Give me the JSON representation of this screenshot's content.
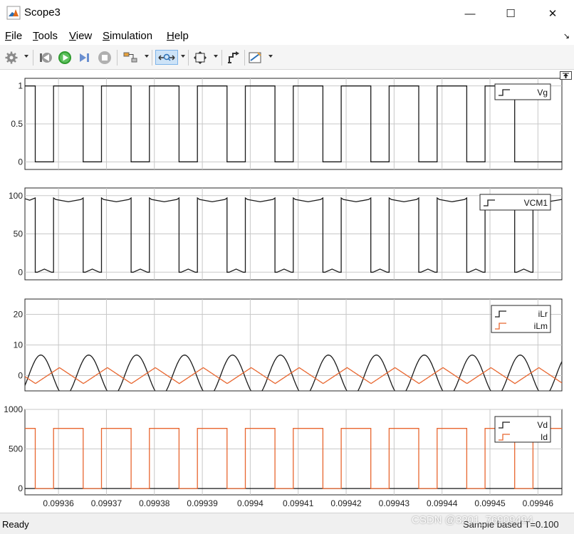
{
  "window": {
    "title": "Scope3",
    "minimize_glyph": "—",
    "maximize_glyph": "☐",
    "close_glyph": "✕"
  },
  "menu": {
    "items": [
      {
        "label": "File",
        "accel": "F",
        "rest": "ile"
      },
      {
        "label": "Tools",
        "accel": "T",
        "rest": "ools"
      },
      {
        "label": "View",
        "accel": "V",
        "rest": "iew"
      },
      {
        "label": "Simulation",
        "accel": "S",
        "rest": "imulation"
      },
      {
        "label": "Help",
        "accel": "H",
        "rest": "elp"
      }
    ],
    "overflow_glyph": "↘"
  },
  "toolbar": {
    "icons": [
      "gear-icon",
      "step-back-icon",
      "run-icon",
      "step-forward-icon",
      "stop-icon",
      "highlight-block-icon",
      "zoom-x-icon",
      "autoscale-icon",
      "style-icon",
      "measurements-icon"
    ]
  },
  "colors": {
    "signal_black": "#1a1a1a",
    "signal_orange": "#e8662f",
    "grid": "#c8c8c8",
    "axes_bg": "#ffffff"
  },
  "status": {
    "left": "Ready",
    "right": "Sample based  T=0.100",
    "watermark": "CSDN @3201_76909494"
  },
  "chart_data": [
    {
      "type": "line",
      "title": "",
      "xlim": [
        0.099353,
        0.099465
      ],
      "ylim": [
        -0.1,
        1.1
      ],
      "yticks": [
        {
          "v": 1,
          "label": "1"
        },
        {
          "v": 0.5,
          "label": "0.5"
        },
        {
          "v": 0,
          "label": "0"
        }
      ],
      "legend_placement": "top-right",
      "series": [
        {
          "name": "Vg",
          "color": "#1a1a1a",
          "x": [
            0.099353,
            0.09935515,
            0.09935515,
            0.09935897,
            0.09935897,
            0.09936515,
            0.09936515,
            0.09936897,
            0.09936897,
            0.09937515,
            0.09937515,
            0.09937897,
            0.09937897,
            0.09938515,
            0.09938515,
            0.09938897,
            0.09938897,
            0.09939515,
            0.09939515,
            0.09939897,
            0.09939897,
            0.09940515,
            0.09940515,
            0.09940897,
            0.09940897,
            0.09941515,
            0.09941515,
            0.09941897,
            0.09941897,
            0.09942515,
            0.09942515,
            0.09942897,
            0.09942897,
            0.09943515,
            0.09943515,
            0.09943897,
            0.09943897,
            0.09944515,
            0.09944515,
            0.09944897,
            0.09944897,
            0.09945515,
            0.09945515,
            0.099465
          ],
          "y": [
            1,
            1,
            0,
            0,
            1,
            1,
            0,
            0,
            1,
            1,
            0,
            0,
            1,
            1,
            0,
            0,
            1,
            1,
            0,
            0,
            1,
            1,
            0,
            0,
            1,
            1,
            0,
            0,
            1,
            1,
            0,
            0,
            1,
            1,
            0,
            0,
            1,
            1,
            0,
            0,
            1,
            1,
            0,
            0
          ]
        }
      ]
    },
    {
      "type": "line",
      "title": "",
      "xlim": [
        0.099353,
        0.099465
      ],
      "ylim": [
        -10,
        110
      ],
      "yticks": [
        {
          "v": 100,
          "label": "100"
        },
        {
          "v": 50,
          "label": "50"
        },
        {
          "v": 0,
          "label": "0"
        }
      ],
      "legend_placement": "top-right",
      "series": [
        {
          "name": "VCM1",
          "color": "#1a1a1a",
          "x": [
            0.099353,
            0.099354,
            0.09935515,
            0.09935515,
            0.0993556,
            0.09935706,
            0.09935852,
            0.09935897,
            0.09935897,
            0.0993594,
            0.09936206,
            0.09936472,
            0.09936515,
            0.09936515,
            0.0993656,
            0.09936706,
            0.09936852,
            0.09936897,
            0.09936897,
            0.0993694,
            0.09937206,
            0.09937472,
            0.09937515,
            0.09937515,
            0.0993756,
            0.09937706,
            0.09937852,
            0.09937897,
            0.09937897,
            0.0993794,
            0.09938206,
            0.09938472,
            0.09938515,
            0.09938515,
            0.0993856,
            0.09938706,
            0.09938852,
            0.09938897,
            0.09938897,
            0.0993894,
            0.09939206,
            0.09939472,
            0.09939515,
            0.09939515,
            0.0993956,
            0.09939706,
            0.09939852,
            0.09939897,
            0.09939897,
            0.0993994,
            0.09940206,
            0.09940472,
            0.09940515,
            0.09940515,
            0.0994056,
            0.09940706,
            0.09940852,
            0.09940897,
            0.09940897,
            0.0994094,
            0.09941206,
            0.09941472,
            0.09941515,
            0.09941515,
            0.0994156,
            0.09941706,
            0.09941852,
            0.09941897,
            0.09941897,
            0.0994194,
            0.09942206,
            0.09942472,
            0.09942515,
            0.09942515,
            0.0994256,
            0.09942706,
            0.09942852,
            0.09942897,
            0.09942897,
            0.0994294,
            0.09943206,
            0.09943472,
            0.09943515,
            0.09943515,
            0.0994356,
            0.09943706,
            0.09943852,
            0.09943897,
            0.09943897,
            0.0994394,
            0.09944206,
            0.09944472,
            0.09944515,
            0.09944515,
            0.0994456,
            0.09944706,
            0.09944852,
            0.09944897,
            0.09944897,
            0.0994494,
            0.09945206,
            0.09945472,
            0.09945515,
            0.09945515,
            0.0994556,
            0.09945706,
            0.09945852,
            0.09945897,
            0.09945897,
            0.0994594,
            0.099462,
            0.099465
          ],
          "y": [
            96,
            94,
            97,
            0,
            0,
            4,
            0,
            0,
            97,
            95,
            92,
            95,
            97,
            0,
            0,
            4,
            0,
            0,
            97,
            95,
            92,
            95,
            97,
            0,
            0,
            4,
            0,
            0,
            97,
            95,
            92,
            95,
            97,
            0,
            0,
            4,
            0,
            0,
            97,
            95,
            92,
            95,
            97,
            0,
            0,
            4,
            0,
            0,
            97,
            95,
            92,
            95,
            97,
            0,
            0,
            4,
            0,
            0,
            97,
            95,
            92,
            95,
            97,
            0,
            0,
            4,
            0,
            0,
            97,
            95,
            92,
            95,
            97,
            0,
            0,
            4,
            0,
            0,
            97,
            95,
            92,
            95,
            97,
            0,
            0,
            4,
            0,
            0,
            97,
            95,
            92,
            95,
            97,
            0,
            0,
            4,
            0,
            0,
            97,
            95,
            92,
            95,
            97,
            0,
            0,
            4,
            0,
            0,
            97,
            95,
            92,
            95
          ]
        }
      ]
    },
    {
      "type": "line",
      "title": "",
      "xlim": [
        0.099353,
        0.099465
      ],
      "ylim": [
        -5,
        25
      ],
      "yticks": [
        {
          "v": 20,
          "label": "20"
        },
        {
          "v": 10,
          "label": "10"
        },
        {
          "v": 0,
          "label": "0"
        }
      ],
      "legend_placement": "top-right",
      "series": [
        {
          "name": "iLr",
          "color": "#1a1a1a",
          "model": "sine",
          "amplitude": 6.7,
          "period": 1e-05,
          "peak_x": 0.0993563,
          "offset": 0
        },
        {
          "name": "iLm",
          "color": "#e8662f",
          "model": "triangle",
          "amplitude": 2.6,
          "period": 1e-05,
          "peak_x": 0.0993602,
          "offset": 0
        }
      ]
    },
    {
      "type": "line",
      "title": "",
      "xlim": [
        0.099353,
        0.099465
      ],
      "ylim": [
        -80,
        1000
      ],
      "yticks": [
        {
          "v": 1000,
          "label": "1000"
        },
        {
          "v": 500,
          "label": "500"
        },
        {
          "v": 0,
          "label": "0"
        }
      ],
      "legend_placement": "top-right",
      "series": [
        {
          "name": "Vd",
          "color": "#1a1a1a",
          "x": [
            0.099353,
            0.099465
          ],
          "y": [
            0,
            0
          ]
        },
        {
          "name": "Id",
          "color": "#e8662f",
          "x": [
            0.099353,
            0.09935515,
            0.09935515,
            0.09935897,
            0.09935897,
            0.09936515,
            0.09936515,
            0.09936897,
            0.09936897,
            0.09937515,
            0.09937515,
            0.09937897,
            0.09937897,
            0.09938515,
            0.09938515,
            0.09938897,
            0.09938897,
            0.09939515,
            0.09939515,
            0.09939897,
            0.09939897,
            0.09940515,
            0.09940515,
            0.09940897,
            0.09940897,
            0.09941515,
            0.09941515,
            0.09941897,
            0.09941897,
            0.09942515,
            0.09942515,
            0.09942897,
            0.09942897,
            0.09943515,
            0.09943515,
            0.09943897,
            0.09943897,
            0.09944515,
            0.09944515,
            0.09944897,
            0.09944897,
            0.09945515,
            0.09945515,
            0.09945897,
            0.09945897,
            0.099465
          ],
          "y": [
            760,
            760,
            0,
            0,
            760,
            760,
            0,
            0,
            760,
            760,
            0,
            0,
            760,
            760,
            0,
            0,
            760,
            760,
            0,
            0,
            760,
            760,
            0,
            0,
            760,
            760,
            0,
            0,
            760,
            760,
            0,
            0,
            760,
            760,
            0,
            0,
            760,
            760,
            0,
            0,
            760,
            760,
            0,
            0,
            760,
            760
          ]
        }
      ],
      "xticks": [
        {
          "v": 0.09936,
          "label": "0.09936"
        },
        {
          "v": 0.09937,
          "label": "0.09937"
        },
        {
          "v": 0.09938,
          "label": "0.09938"
        },
        {
          "v": 0.09939,
          "label": "0.09939"
        },
        {
          "v": 0.0994,
          "label": "0.0994"
        },
        {
          "v": 0.09941,
          "label": "0.09941"
        },
        {
          "v": 0.09942,
          "label": "0.09942"
        },
        {
          "v": 0.09943,
          "label": "0.09943"
        },
        {
          "v": 0.09944,
          "label": "0.09944"
        },
        {
          "v": 0.09945,
          "label": "0.09945"
        },
        {
          "v": 0.09946,
          "label": "0.09946"
        }
      ]
    }
  ]
}
